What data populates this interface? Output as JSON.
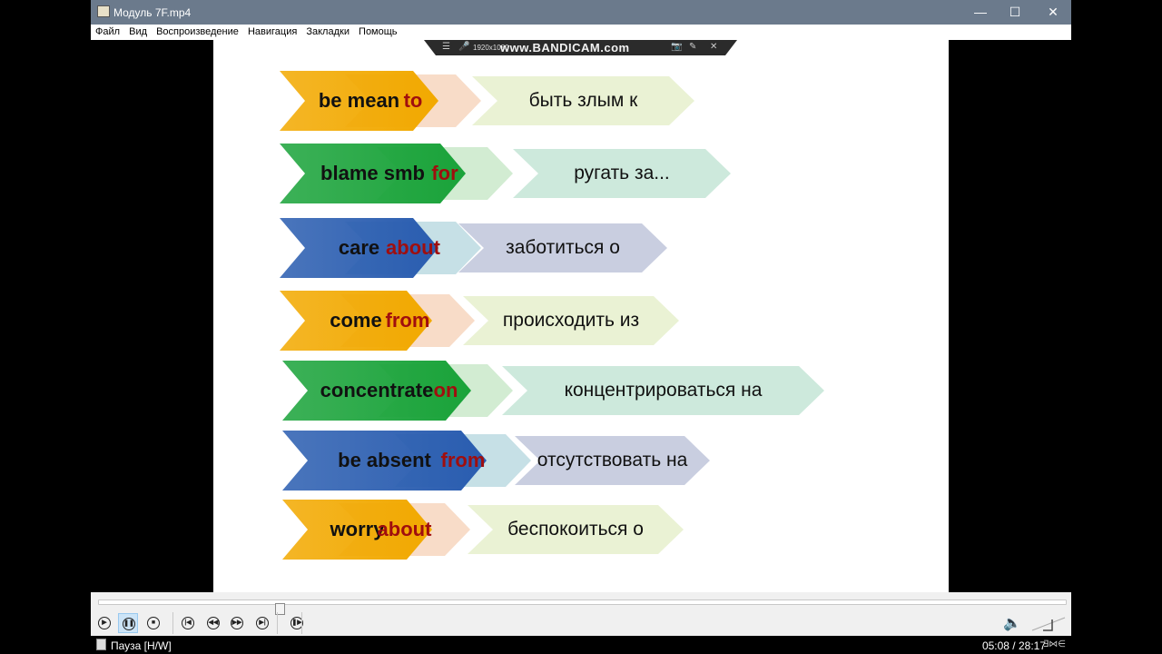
{
  "window": {
    "title": "Модуль 7F.mp4",
    "minimize_label": "—",
    "maximize_label": "☐",
    "close_label": "✕"
  },
  "menu": [
    {
      "label": "Файл"
    },
    {
      "label": "Вид"
    },
    {
      "label": "Воспроизведение"
    },
    {
      "label": "Навигация"
    },
    {
      "label": "Закладки"
    },
    {
      "label": "Помощь"
    }
  ],
  "overlay": {
    "resolution": "1920x1080",
    "watermark": "www.BANDICAM.com"
  },
  "slide": {
    "rows": [
      {
        "verb": "be mean",
        "prep": "to",
        "translation": "быть злым к",
        "color": "#f2a900",
        "prep_color": "#f8dcc8",
        "tr_color": "#eaf2d4"
      },
      {
        "verb": "blame smb",
        "prep": "for",
        "translation": "ругать за...",
        "color": "#1aa33a",
        "prep_color": "#d2ecd2",
        "tr_color": "#cde9dc"
      },
      {
        "verb": "care",
        "prep": "about",
        "translation": "заботиться о",
        "color": "#2a5db0",
        "prep_color": "#c6e0e6",
        "tr_color": "#c9cee0"
      },
      {
        "verb": "come",
        "prep": "from",
        "translation": "происходить из",
        "color": "#f2a900",
        "prep_color": "#f8dcc8",
        "tr_color": "#eaf2d4"
      },
      {
        "verb": "concentrate",
        "prep": "on",
        "translation": "концентрироваться на",
        "color": "#1aa33a",
        "prep_color": "#d2ecd2",
        "tr_color": "#cde9dc"
      },
      {
        "verb": "be absent",
        "prep": "from",
        "translation": "отсутствовать на",
        "color": "#2a5db0",
        "prep_color": "#c6e0e6",
        "tr_color": "#c9cee0"
      },
      {
        "verb": "worry",
        "prep": "about",
        "translation": "беспокоиться о",
        "color": "#f2a900",
        "prep_color": "#f8dcc8",
        "tr_color": "#eaf2d4"
      }
    ]
  },
  "player": {
    "progress_fraction": 0.182,
    "buttons": [
      {
        "name": "play-button",
        "icon": "▶"
      },
      {
        "name": "pause-button",
        "icon": "❚❚",
        "active": true
      },
      {
        "name": "stop-button",
        "icon": "■"
      },
      {
        "name": "previous-button",
        "icon": "|◀"
      },
      {
        "name": "rewind-button",
        "icon": "◀◀"
      },
      {
        "name": "forward-button",
        "icon": "▶▶"
      },
      {
        "name": "next-button",
        "icon": "▶|"
      },
      {
        "name": "frame-step-button",
        "icon": "❚▶"
      }
    ],
    "volume_icon": "🔈"
  },
  "status": {
    "state": "Пауза [H/W]",
    "time": "05:08 / 28:17",
    "hw_badge": "∃⋈∈"
  }
}
